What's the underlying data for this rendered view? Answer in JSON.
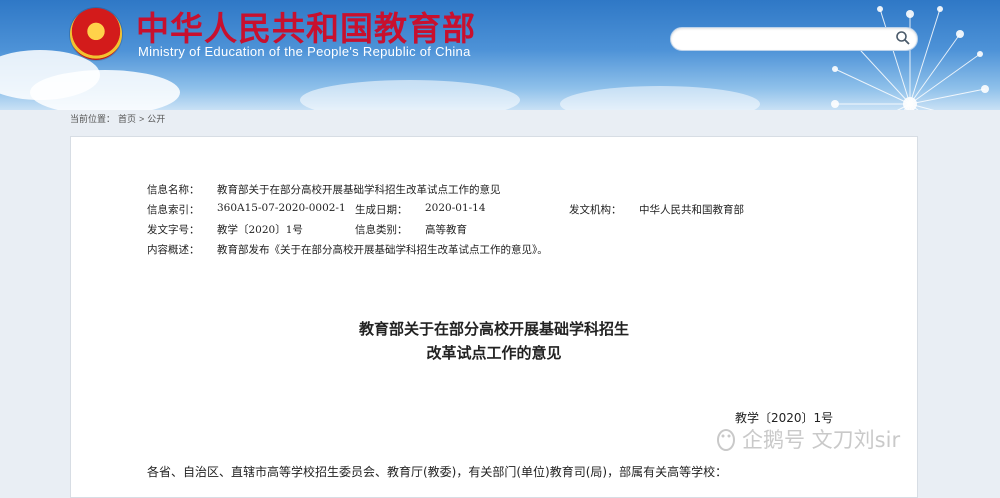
{
  "header": {
    "site_name_cn": "中华人民共和国教育部",
    "site_name_en": "Ministry of Education of the People's Republic of China",
    "search": {
      "placeholder": ""
    }
  },
  "breadcrumb": {
    "prefix": "当前位置：",
    "home": "首页",
    "separator": ">",
    "current": "公开"
  },
  "document": {
    "meta": {
      "name_label": "信息名称：",
      "name_value": "教育部关于在部分高校开展基础学科招生改革试点工作的意见",
      "index_label": "信息索引：",
      "index_value": "360A15-07-2020-0002-1",
      "date_label": "生成日期：",
      "date_value": "2020-01-14",
      "issuer_label": "发文机构：",
      "issuer_value": "中华人民共和国教育部",
      "docno_label": "发文字号：",
      "docno_value": "教学〔2020〕1号",
      "category_label": "信息类别：",
      "category_value": "高等教育",
      "summary_label": "内容概述：",
      "summary_value": "教育部发布《关于在部分高校开展基础学科招生改革试点工作的意见》。"
    },
    "title_line1": "教育部关于在部分高校开展基础学科招生",
    "title_line2": "改革试点工作的意见",
    "doc_number": "教学〔2020〕1号",
    "addressee": "各省、自治区、直辖市高等学校招生委员会、教育厅(教委)，有关部门(单位)教育司(局)，部属有关高等学校："
  },
  "watermark": {
    "text": "企鹅号 文刀刘sir"
  },
  "colors": {
    "site_name": "#c8102e",
    "banner_top": "#2f78c6",
    "banner_bottom": "#c9e1f5"
  },
  "icons": {
    "emblem": "national-emblem-icon",
    "search": "magnifier-icon",
    "watermark_logo": "penguin-icon"
  }
}
